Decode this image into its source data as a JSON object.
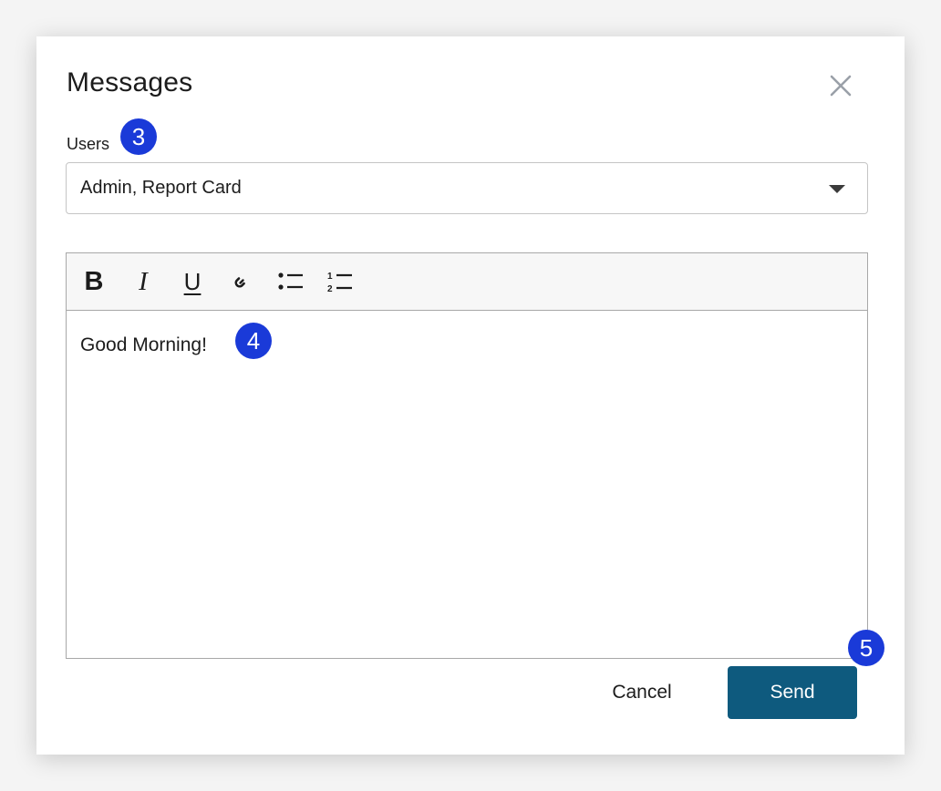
{
  "dialog": {
    "title": "Messages",
    "close_icon": "close-icon"
  },
  "users_field": {
    "label": "Users",
    "value": "Admin, Report Card",
    "caret_icon": "chevron-down-icon"
  },
  "editor": {
    "toolbar": {
      "bold_label": "B",
      "italic_label": "I",
      "underline_label": "U",
      "link_icon": "link-icon",
      "bullet_list_icon": "bullet-list-icon",
      "numbered_list_icon": "numbered-list-icon"
    },
    "content": "Good Morning!"
  },
  "actions": {
    "cancel_label": "Cancel",
    "send_label": "Send"
  },
  "step_badges": {
    "users": "3",
    "message": "4",
    "send": "5",
    "color": "#1a3ad8"
  },
  "colors": {
    "send_button": "#0e5a7e",
    "toolbar_bg": "#f7f7f7"
  }
}
